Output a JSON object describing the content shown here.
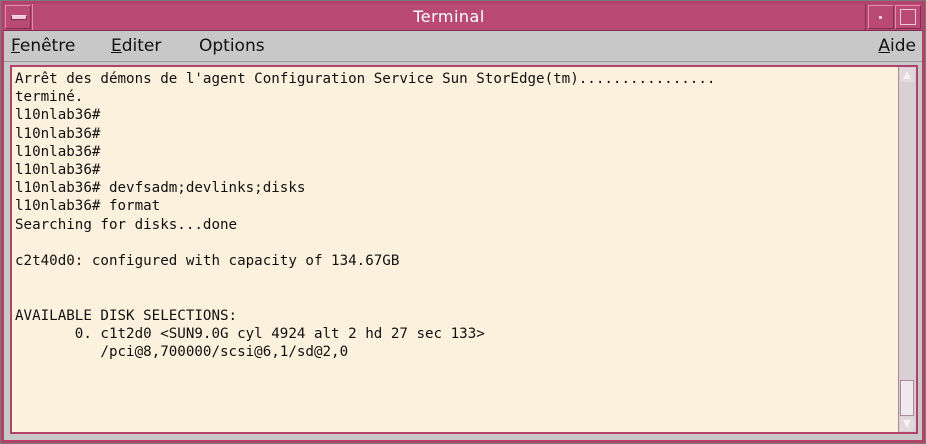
{
  "window": {
    "title": "Terminal",
    "accent_color": "#b84a73",
    "terminal_bg": "#fbf1dd",
    "icons": [
      "window-menu-icon",
      "minimize-icon",
      "maximize-icon"
    ]
  },
  "menubar": {
    "fenetre": {
      "mnemonic": "F",
      "rest": "enêtre"
    },
    "editer": {
      "mnemonic": "E",
      "rest": "diter"
    },
    "options": {
      "label": "Options"
    },
    "aide": {
      "mnemonic": "A",
      "rest": "ide"
    }
  },
  "terminal": {
    "lines": [
      "Arrêt des démons de l'agent Configuration Service Sun StorEdge(tm)................",
      "terminé.",
      "l10nlab36#",
      "l10nlab36#",
      "l10nlab36#",
      "l10nlab36#",
      "l10nlab36# devfsadm;devlinks;disks",
      "l10nlab36# format",
      "Searching for disks...done",
      "",
      "c2t40d0: configured with capacity of 134.67GB",
      "",
      "",
      "AVAILABLE DISK SELECTIONS:",
      "       0. c1t2d0 <SUN9.0G cyl 4924 alt 2 hd 27 sec 133>",
      "          /pci@8,700000/scsi@6,1/sd@2,0"
    ]
  }
}
